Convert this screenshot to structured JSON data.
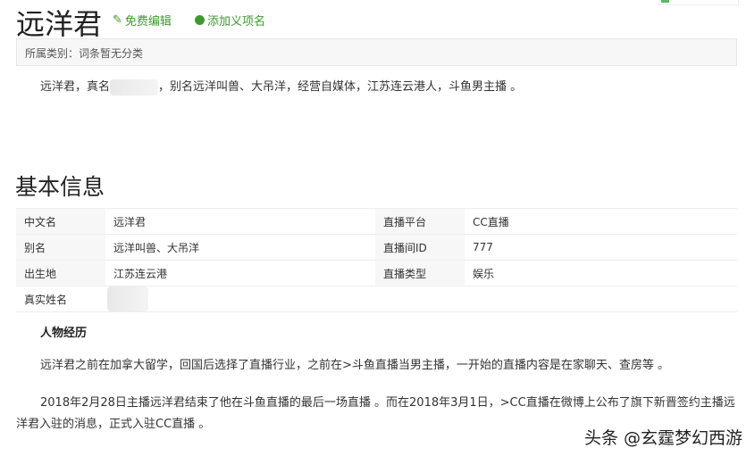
{
  "header": {
    "title": "远洋君",
    "edit_label": "免费编辑",
    "add_label": "添加义项名"
  },
  "category": "所属类别：词条暂无分类",
  "intro": {
    "before": "远洋君，真名",
    "after": "，别名远洋叫兽、大吊洋，经营自媒体，江苏连云港人，斗鱼男主播 。"
  },
  "basic_info": {
    "heading": "基本信息",
    "rows": [
      {
        "k1": "中文名",
        "v1": "远洋君",
        "k2": "直播平台",
        "v2": "CC直播"
      },
      {
        "k1": "别名",
        "v1": "远洋叫兽、大吊洋",
        "k2": "直播间ID",
        "v2": "777"
      },
      {
        "k1": "出生地",
        "v1": "江苏连云港",
        "k2": "直播类型",
        "v2": "娱乐"
      },
      {
        "k1": "真实姓名",
        "v1": "",
        "k2": "",
        "v2": ""
      }
    ]
  },
  "experience": {
    "heading": "人物经历",
    "p1": "远洋君之前在加拿大留学，回国后选择了直播行业，之前在>斗鱼直播当男主播，一开始的直播内容是在家聊天、查房等 。",
    "p2": "2018年2月28日主播远洋君结束了他在斗鱼直播的最后一场直播 。而在2018年3月1日，>CC直播在微博上公布了旗下新晋签约主播远洋君入驻的消息，正式入驻CC直播 。"
  },
  "watermark": "头条 @玄霆梦幻西游",
  "colors": {
    "accent": "#3a9b2c"
  }
}
